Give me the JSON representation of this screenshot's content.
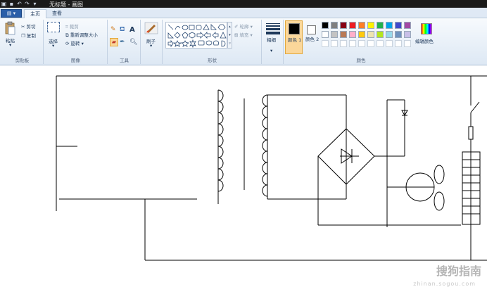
{
  "window": {
    "title": "无标题 - 画图"
  },
  "tabs": {
    "file_label": "",
    "home": "主页",
    "view": "查看"
  },
  "clipboard": {
    "paste": "粘贴",
    "cut": "剪切",
    "copy": "复制",
    "label": "剪贴板"
  },
  "image": {
    "select": "选择",
    "crop": "裁剪",
    "resize": "重新调整大小",
    "rotate": "旋转",
    "label": "图像"
  },
  "tools": {
    "label": "工具"
  },
  "brushes": {
    "label": "刷子"
  },
  "shapes": {
    "outline": "轮廓",
    "fill": "填充",
    "label": "形状"
  },
  "size": {
    "label": "粗细"
  },
  "colors": {
    "color1_label": "颜色 1",
    "color2_label": "颜色 2",
    "edit_label": "编辑颜色",
    "label": "颜色",
    "color1": "#000000",
    "color2": "#ffffff",
    "palette_row1": [
      "#000000",
      "#7f7f7f",
      "#880015",
      "#ed1c24",
      "#ff7f27",
      "#fff200",
      "#22b14c",
      "#00a2e8",
      "#3f48cc",
      "#a349a4"
    ],
    "palette_row2": [
      "#ffffff",
      "#c3c3c3",
      "#b97a57",
      "#ffaec9",
      "#ffc90e",
      "#efe4b0",
      "#b5e61d",
      "#99d9ea",
      "#7092be",
      "#c8bfe7"
    ]
  },
  "watermark": {
    "main": "搜狗指南",
    "url": "zhinan.sogou.com"
  }
}
